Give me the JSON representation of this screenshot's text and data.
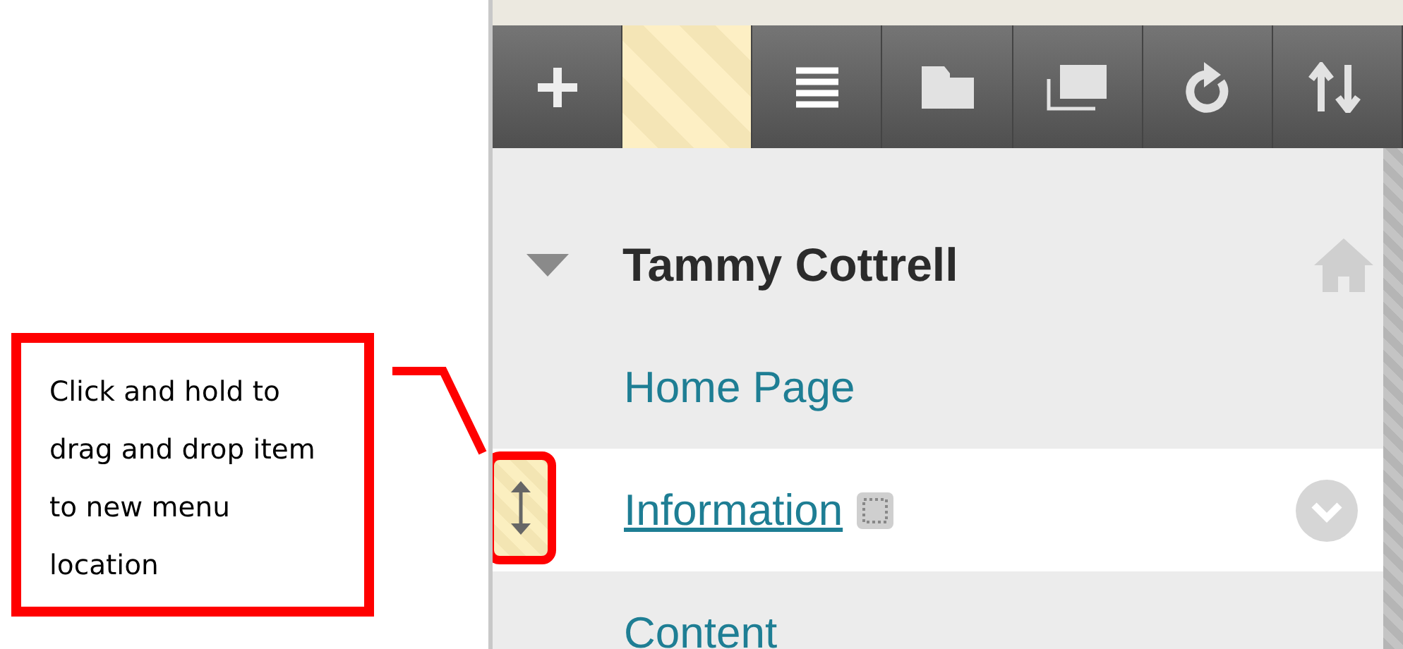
{
  "callout": {
    "text": "Click and hold to drag and drop item to new menu location"
  },
  "toolbar": [
    {
      "kind": "add"
    },
    {
      "kind": "placeholder"
    },
    {
      "kind": "list"
    },
    {
      "kind": "folder"
    },
    {
      "kind": "windows"
    },
    {
      "kind": "refresh"
    },
    {
      "kind": "sort"
    }
  ],
  "menu": {
    "title": "Tammy Cottrell",
    "items": [
      {
        "label": "Home Page",
        "selected": false
      },
      {
        "label": "Information",
        "selected": true
      },
      {
        "label": "Content",
        "selected": false
      }
    ]
  }
}
